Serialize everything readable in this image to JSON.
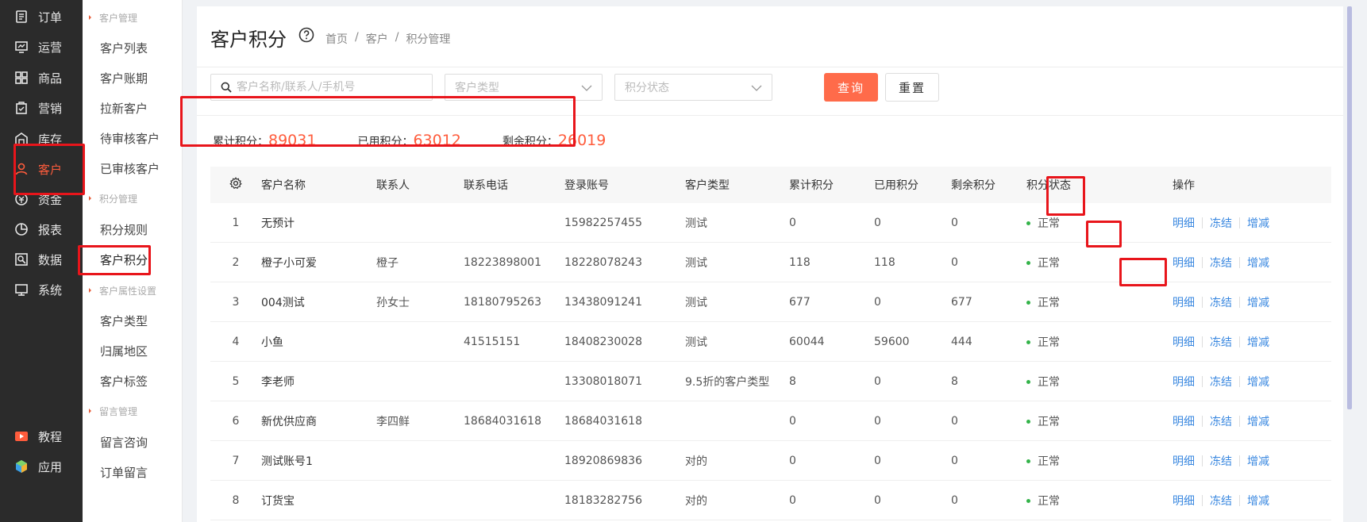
{
  "nav1": [
    {
      "label": "订单",
      "icon": "order-icon"
    },
    {
      "label": "运营",
      "icon": "operation-icon"
    },
    {
      "label": "商品",
      "icon": "goods-icon"
    },
    {
      "label": "营销",
      "icon": "marketing-icon"
    },
    {
      "label": "库存",
      "icon": "warehouse-icon"
    },
    {
      "label": "客户",
      "icon": "user-icon",
      "active": true
    },
    {
      "label": "资金",
      "icon": "money-icon"
    },
    {
      "label": "报表",
      "icon": "report-icon"
    },
    {
      "label": "数据",
      "icon": "data-icon"
    },
    {
      "label": "系统",
      "icon": "system-icon"
    },
    {
      "label": "教程",
      "icon": "video-icon"
    },
    {
      "label": "应用",
      "icon": "app-icon"
    }
  ],
  "nav2": {
    "groups": [
      "客户管理",
      "积分管理",
      "客户属性设置",
      "留言管理"
    ],
    "items": [
      "客户列表",
      "客户账期",
      "拉新客户",
      "待审核客户",
      "已审核客户",
      "积分规则",
      "客户积分",
      "客户类型",
      "归属地区",
      "客户标签",
      "留言咨询",
      "订单留言"
    ]
  },
  "header": {
    "title": "客户积分",
    "breadcrumb": [
      "首页",
      "/",
      "客户",
      "/",
      "积分管理"
    ]
  },
  "filters": {
    "search_placeholder": "客户名称/联系人/手机号",
    "type_placeholder": "客户类型",
    "status_placeholder": "积分状态",
    "query_label": "查询",
    "reset_label": "重置"
  },
  "stats": {
    "total_label": "累计积分：",
    "total_value": "89031",
    "used_label": "已用积分：",
    "used_value": "63012",
    "remaining_label": "剩余积分：",
    "remaining_value": "26019"
  },
  "table": {
    "headers": [
      "客户名称",
      "联系人",
      "联系电话",
      "登录账号",
      "客户类型",
      "累计积分",
      "已用积分",
      "剩余积分",
      "积分状态",
      "操作"
    ],
    "rows": [
      [
        "1",
        "无预计",
        "",
        "",
        "15982257455",
        "测试",
        "0",
        "0",
        "0",
        "正常"
      ],
      [
        "2",
        "橙子小可爱",
        "橙子",
        "18223898001",
        "18228078243",
        "测试",
        "118",
        "118",
        "0",
        "正常"
      ],
      [
        "3",
        "004测试",
        "孙女士",
        "18180795263",
        "13438091241",
        "测试",
        "677",
        "0",
        "677",
        "正常"
      ],
      [
        "4",
        "小鱼",
        "",
        "41515151",
        "18408230028",
        "测试",
        "60044",
        "59600",
        "444",
        "正常"
      ],
      [
        "5",
        "李老师",
        "",
        "",
        "13308018071",
        "9.5折的客户类型",
        "8",
        "0",
        "8",
        "正常"
      ],
      [
        "6",
        "新优供应商",
        "李四鲜",
        "18684031618",
        "18684031618",
        "",
        "0",
        "0",
        "0",
        "正常"
      ],
      [
        "7",
        "测试账号1",
        "",
        "",
        "18920869836",
        "对的",
        "0",
        "0",
        "0",
        "正常"
      ],
      [
        "8",
        "订货宝",
        "",
        "",
        "18183282756",
        "对的",
        "0",
        "0",
        "0",
        "正常"
      ]
    ],
    "actions": [
      "明细",
      "冻结",
      "增减"
    ]
  },
  "colors": {
    "accent": "#ff6b4a",
    "link": "#3a88e0",
    "annotation": "#e8151b",
    "status_ok": "#33b349"
  }
}
